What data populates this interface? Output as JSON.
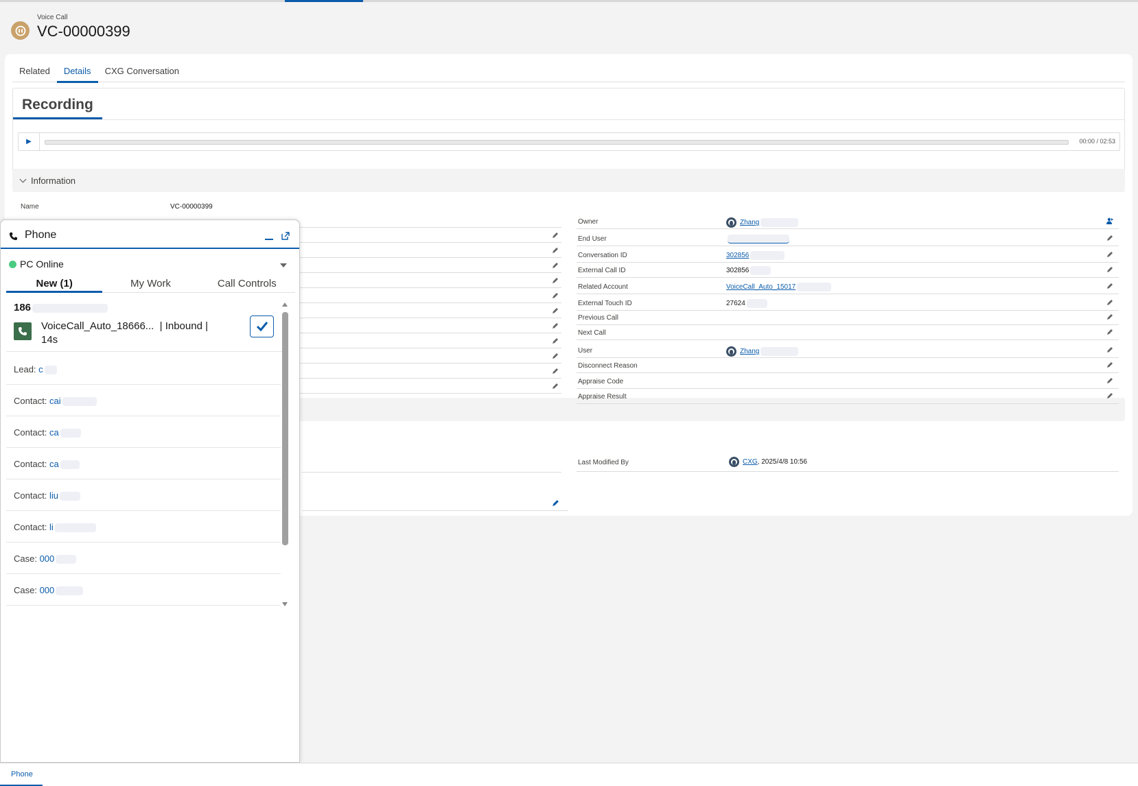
{
  "record": {
    "type": "Voice Call",
    "name": "VC-00000399"
  },
  "tabs": [
    "Related",
    "Details",
    "CXG Conversation"
  ],
  "recording": {
    "title": "Recording",
    "time": "00:00 / 02:53"
  },
  "information": {
    "title": "Information",
    "left_fields": [
      {
        "label": "Name",
        "value": "VC-00000399"
      }
    ],
    "right_fields": [
      {
        "label": "Owner",
        "value": "Zhang"
      },
      {
        "label": "End User",
        "value": ""
      },
      {
        "label": "Conversation ID",
        "value": "302856"
      },
      {
        "label": "External Call ID",
        "value": "302856"
      },
      {
        "label": "Related Account",
        "value": "VoiceCall_Auto_15017"
      },
      {
        "label": "External Touch ID",
        "value": "27624"
      },
      {
        "label": "Previous Call",
        "value": ""
      },
      {
        "label": "Next Call",
        "value": ""
      },
      {
        "label": "User",
        "value": "Zhang"
      },
      {
        "label": "Disconnect Reason",
        "value": ""
      },
      {
        "label": "Appraise Code",
        "value": ""
      },
      {
        "label": "Appraise Result",
        "value": ""
      }
    ]
  },
  "system": {
    "last_modified_label": "Last Modified By",
    "last_modified_user": "CXG",
    "last_modified_date": ", 2025/4/8 10:56"
  },
  "phone": {
    "title": "Phone",
    "status": "PC Online",
    "tabs": [
      "New (1)",
      "My Work",
      "Call Controls"
    ],
    "work_item": {
      "number": "186",
      "subject": "VoiceCall_Auto_18666...",
      "direction": "| Inbound |",
      "duration": "14s"
    },
    "related": [
      {
        "label": "Lead:",
        "value": "c"
      },
      {
        "label": "Contact:",
        "value": "cai"
      },
      {
        "label": "Contact:",
        "value": "ca"
      },
      {
        "label": "Contact:",
        "value": "ca"
      },
      {
        "label": "Contact:",
        "value": "liu"
      },
      {
        "label": "Contact:",
        "value": "li"
      },
      {
        "label": "Case:",
        "value": "000"
      },
      {
        "label": "Case:",
        "value": "000"
      }
    ]
  },
  "utility_bar": {
    "item": "Phone"
  },
  "colors": {
    "brand": "#0b5cab",
    "online": "#4bca81",
    "record_icon": "#c9a26b"
  }
}
